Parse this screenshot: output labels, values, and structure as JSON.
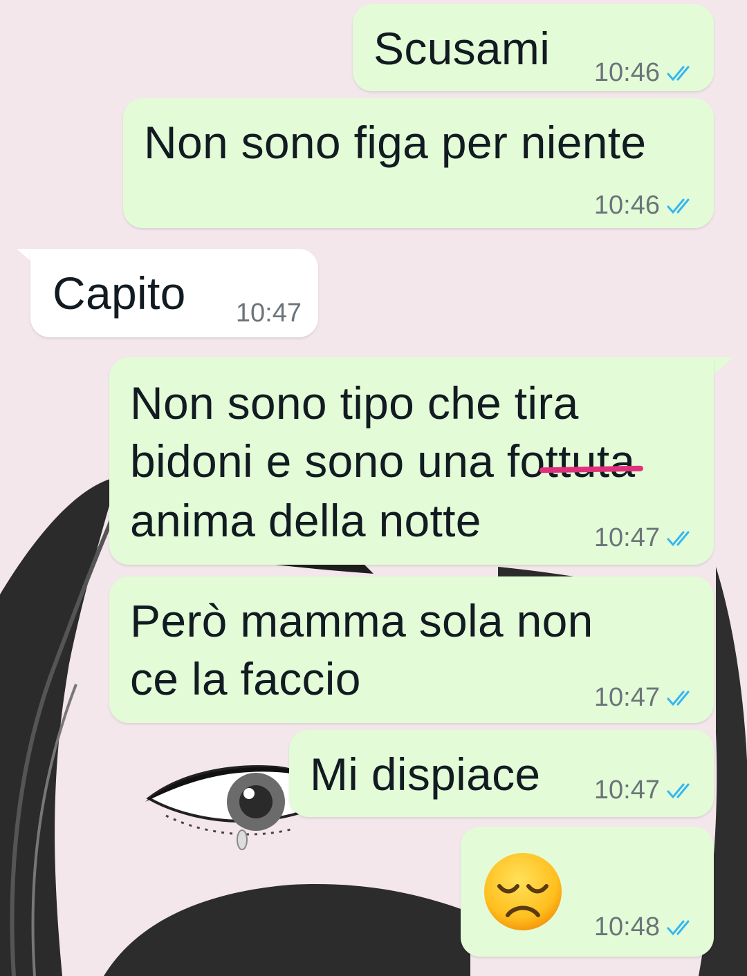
{
  "messages": [
    {
      "text": "Scusami",
      "time": "10:46",
      "direction": "out",
      "status": "read"
    },
    {
      "text": "Non sono figa per niente",
      "time": "10:46",
      "direction": "out",
      "status": "read"
    },
    {
      "text": "Capito",
      "time": "10:47",
      "direction": "in"
    },
    {
      "lines": [
        "Non sono tipo che tira",
        "bidoni e sono una fottuta",
        "anima della notte"
      ],
      "time": "10:47",
      "direction": "out",
      "status": "read",
      "struck_word": "fottu"
    },
    {
      "lines": [
        "Però mamma sola non",
        "ce la faccio"
      ],
      "time": "10:47",
      "direction": "out",
      "status": "read"
    },
    {
      "text": "Mi dispiace",
      "time": "10:47",
      "direction": "out",
      "status": "read"
    },
    {
      "emoji": "disappointed-face",
      "time": "10:48",
      "direction": "out",
      "status": "read"
    }
  ],
  "colors": {
    "outgoing_bubble": "#e3fbd7",
    "incoming_bubble": "#ffffff",
    "read_ticks": "#34b7f1",
    "strike_mark": "#e0317c",
    "wallpaper": "#f3e7ec"
  }
}
